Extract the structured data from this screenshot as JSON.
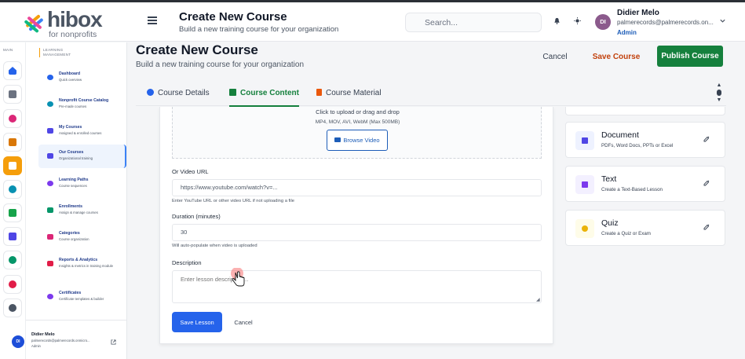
{
  "app": {
    "logo_word": "hibox",
    "logo_sub": "for nonprofits"
  },
  "header": {
    "title": "Create New Course",
    "subtitle": "Build a new training course for your organization",
    "search_placeholder": "Search...",
    "bell_icon": "bell-icon",
    "theme_icon": "sun-icon",
    "user": {
      "initials": "DI",
      "name": "Didier Melo",
      "email": "palmerecords@palmerecords.on...",
      "role": "Admin"
    }
  },
  "rail": {
    "label": "MAIN",
    "colors": [
      "#2563eb",
      "#6b7280",
      "#db2777",
      "#d97706",
      "#f59e0b",
      "#0891b2",
      "#16a34a",
      "#4f46e5",
      "#059669",
      "#e11d48",
      "#4b5563"
    ]
  },
  "nav": {
    "section": "LEARNING MANAGEMENT",
    "items": [
      {
        "title": "Dashboard",
        "sub": "Quick overview"
      },
      {
        "title": "Nonprofit Course Catalog",
        "sub": "Pre-made courses"
      },
      {
        "title": "My Courses",
        "sub": "Assigned & enrolled courses"
      },
      {
        "title": "Our Courses",
        "sub": "Organizational training"
      },
      {
        "title": "Learning Paths",
        "sub": "Course sequences"
      },
      {
        "title": "Enrollments",
        "sub": "Assign & manage courses"
      },
      {
        "title": "Categories",
        "sub": "Course organization"
      },
      {
        "title": "Reports & Analytics",
        "sub": "Insights & metrics in training module"
      },
      {
        "title": "Certificates",
        "sub": "Certificate templates & builder"
      }
    ],
    "footer": {
      "initials": "DI",
      "name": "Didier Melo",
      "email": "palmerecords@palmerecords.onmicro...",
      "role": "Admin"
    }
  },
  "page": {
    "title": "Create New Course",
    "subtitle": "Build a new training course for your organization",
    "cancel_label": "Cancel",
    "save_label": "Save Course",
    "publish_label": "Publish Course",
    "tabs": [
      {
        "label": "Course Details"
      },
      {
        "label": "Course Content"
      },
      {
        "label": "Course Material"
      }
    ]
  },
  "form": {
    "upload_text": "Click to upload or drag and drop",
    "upload_formats": "MP4, MOV, AVI, WebM (Max 500MB)",
    "browse_label": "Browse Video",
    "video_url_label": "Or Video URL",
    "video_url_value": "https://www.youtube.com/watch?v=...",
    "video_url_help": "Enter YouTube URL or other video URL if not uploading a file",
    "duration_label": "Duration (minutes)",
    "duration_value": "30",
    "duration_help": "Will auto-populate when video is uploaded",
    "description_label": "Description",
    "description_placeholder": "Enter lesson description...",
    "save_lesson_label": "Save Lesson",
    "cancel_label": "Cancel"
  },
  "lesson_types": [
    {
      "title": "Document",
      "desc": "PDFs, Word Docs, PPTs or Excel",
      "color": "#eef2ff",
      "glyph": "#4f46e5"
    },
    {
      "title": "Text",
      "desc": "Create a Text-Based Lesson",
      "color": "#f3f0ff",
      "glyph": "#7c3aed"
    },
    {
      "title": "Quiz",
      "desc": "Create a Quiz or Exam",
      "color": "#fefce8",
      "glyph": "#eab308"
    }
  ]
}
